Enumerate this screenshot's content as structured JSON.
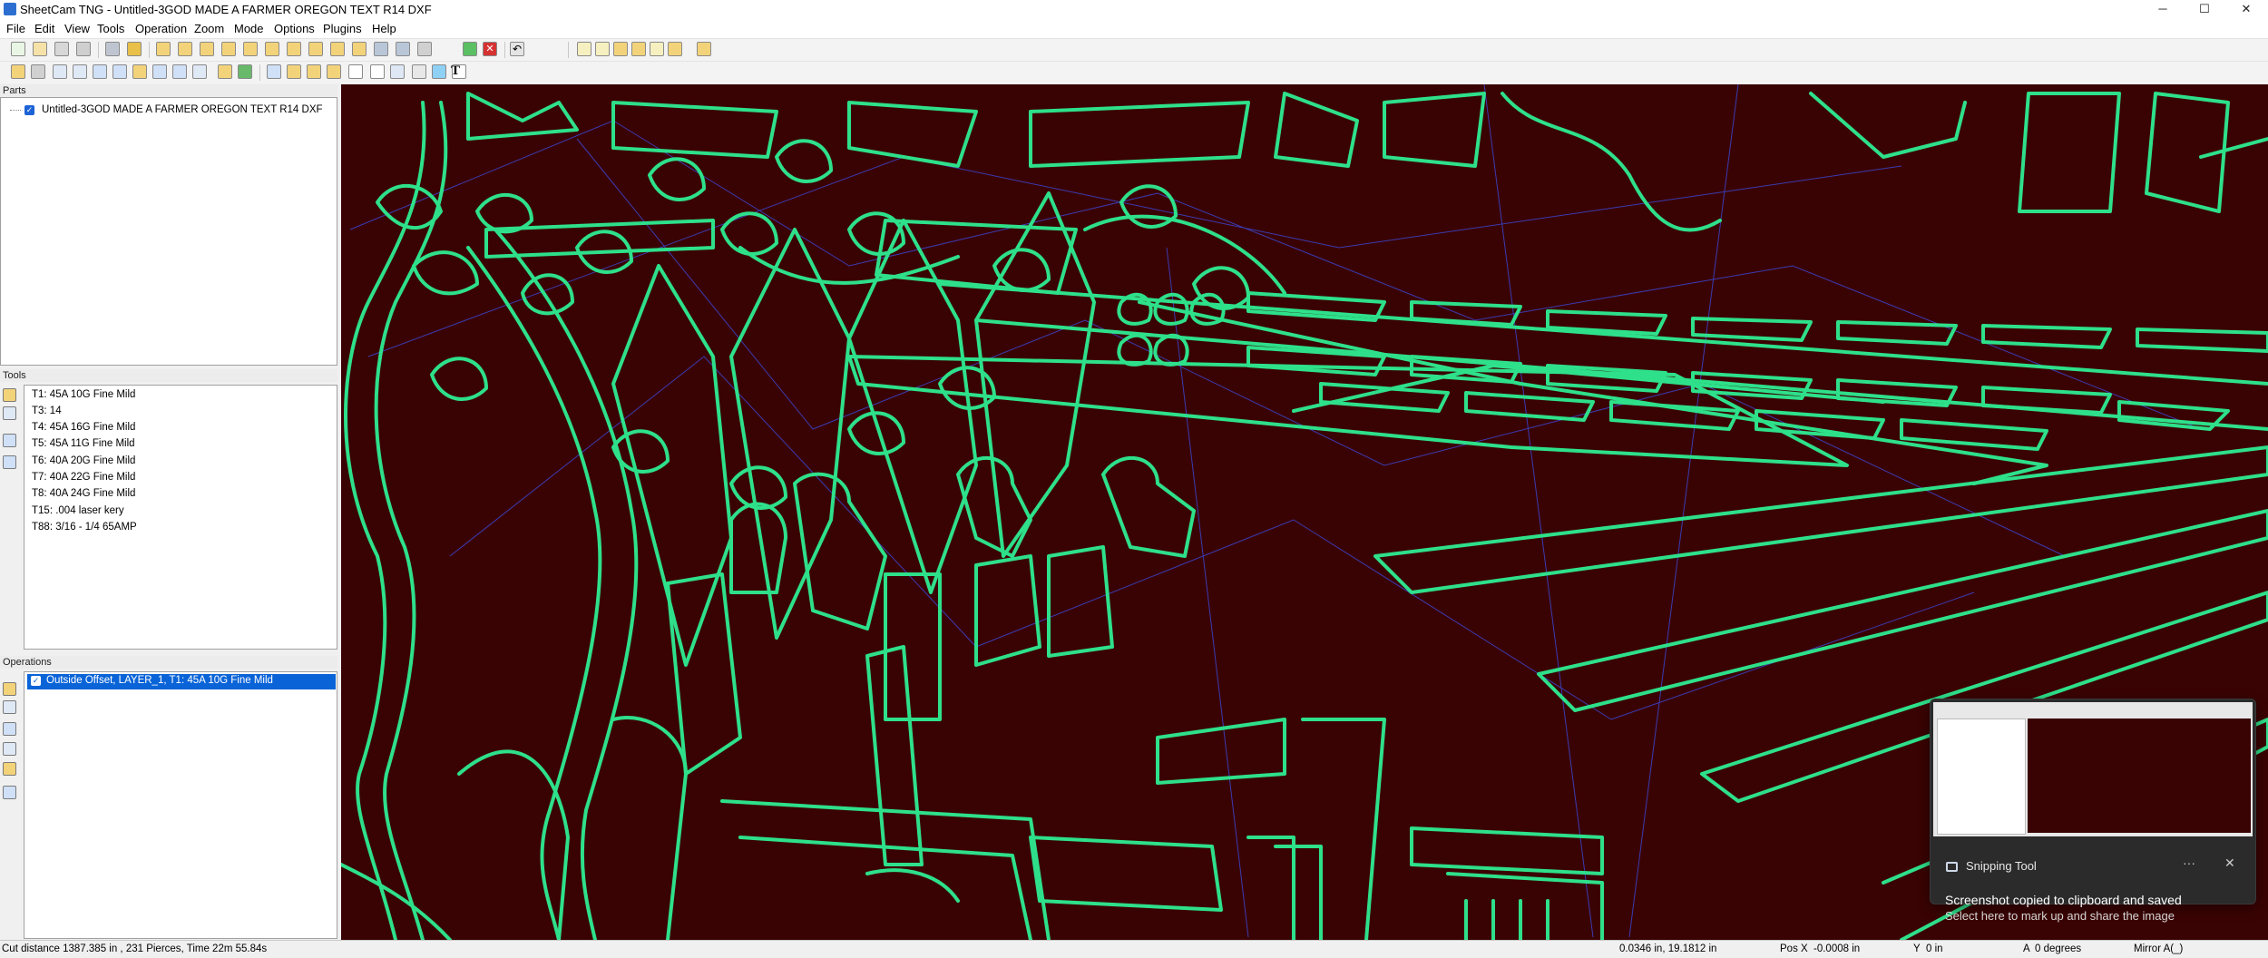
{
  "window": {
    "title": "SheetCam TNG - Untitled-3GOD MADE A FARMER OREGON TEXT R14 DXF",
    "controls": {
      "minimize": "─",
      "maximize": "☐",
      "close": "✕"
    }
  },
  "menu": [
    "File",
    "Edit",
    "View",
    "Tools",
    "Operation",
    "Zoom",
    "Mode",
    "Options",
    "Plugins",
    "Help"
  ],
  "toolbar1": {
    "icons": [
      "new-icon",
      "open-icon",
      "save-icon",
      "print-icon",
      "calculator-icon",
      "import-icon",
      "drawing-icon",
      "layer-icon",
      "contour-icon",
      "tool-icon",
      "offset-icon",
      "start-point-icon",
      "rotate-icon",
      "copy-icon",
      "array-icon",
      "nest-icon",
      "simulate-icon",
      "post-icon",
      "delete-icon",
      "undo-icon"
    ],
    "zoom_icons": [
      "zoom-in-icon",
      "zoom-out-icon",
      "zoom-window-icon",
      "zoom-all-icon",
      "zoom-extents-icon",
      "zoom-previous-icon",
      "zoom-part-icon"
    ]
  },
  "toolbar2": {
    "icons": [
      "view-2d-icon",
      "view-3d-icon",
      "table-icon",
      "drill-icon",
      "line-icon",
      "polyline-icon",
      "arc-icon",
      "pocket-icon",
      "profile-icon",
      "wizard-icon",
      "select-icon",
      "pointer-icon",
      "cut-path-icon",
      "lead-icon",
      "move-icon",
      "origin-icon",
      "scale-icon",
      "rectangle-icon",
      "laser-icon",
      "text-icon"
    ],
    "text_icon_glyph": "T"
  },
  "parts": {
    "header": "Parts",
    "items": [
      {
        "label": "Untitled-3GOD MADE A FARMER OREGON TEXT R14 DXF",
        "checked": true
      }
    ]
  },
  "tools": {
    "header": "Tools",
    "items": [
      "T1: 45A 10G Fine Mild",
      "T3: 14",
      "T4: 45A 16G Fine Mild",
      "T5: 45A 11G Fine Mild",
      "T6: 40A 20G Fine Mild",
      "T7: 40A 22G Fine Mild",
      "T8: 40A 24G Fine Mild",
      "T15: .004 laser kery",
      "T88: 3/16 - 1/4 65AMP"
    ]
  },
  "operations": {
    "header": "Operations",
    "items": [
      {
        "label": "Outside Offset, LAYER_1, T1: 45A 10G Fine Mild",
        "checked": true,
        "selected": true
      }
    ]
  },
  "viewport": {
    "background": "#3a0303",
    "path_color": "#2ee08a",
    "rapid_color": "#3b3bb0"
  },
  "status": {
    "summary": "Cut distance 1387.385 in , 231 Pierces, Time 22m 55.84s",
    "cursor": "0.0346 in, 19.1812 in",
    "pos_x_label": "Pos X",
    "pos_x_value": "-0.0008 in",
    "y_label": "Y",
    "y_value": "0 in",
    "a_label": "A",
    "a_value": "0 degrees",
    "mirror": "Mirror A(_)"
  },
  "toast": {
    "app": "Snipping Tool",
    "message": "Screenshot copied to clipboard and saved",
    "sub": "Select here to mark up and share the image",
    "more": "···",
    "close": "✕"
  }
}
